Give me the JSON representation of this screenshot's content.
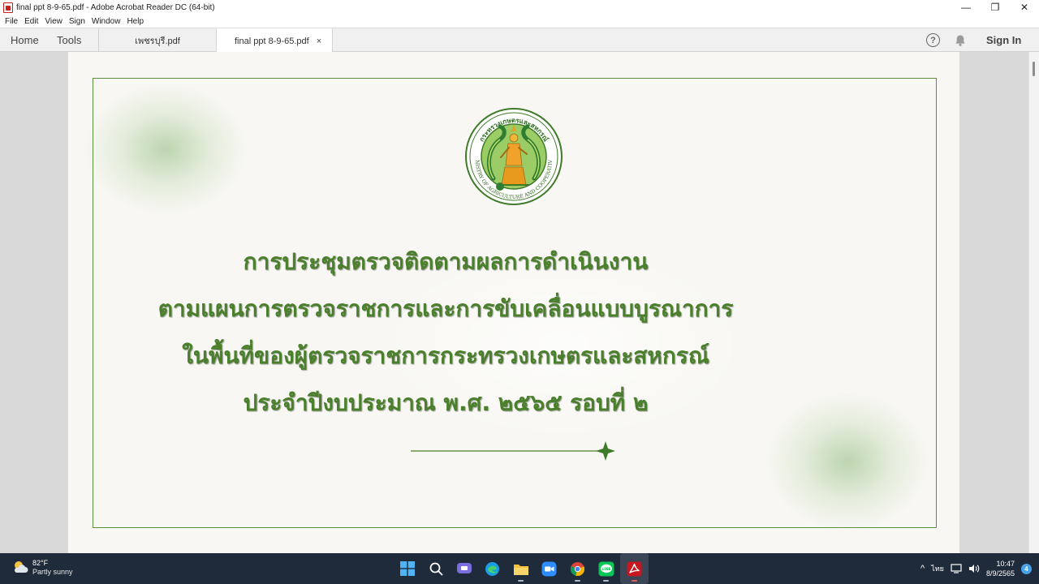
{
  "window": {
    "title": "final ppt 8-9-65.pdf - Adobe Acrobat Reader DC (64-bit)",
    "controls": {
      "minimize": "—",
      "restore": "❐",
      "close": "✕"
    }
  },
  "menu": [
    "File",
    "Edit",
    "View",
    "Sign",
    "Window",
    "Help"
  ],
  "toolbar": {
    "home": "Home",
    "tools": "Tools",
    "tabs": [
      {
        "label": "เพชรบุรี.pdf",
        "active": false
      },
      {
        "label": "final ppt 8-9-65.pdf",
        "active": true,
        "close": "×"
      }
    ],
    "help_icon": "?",
    "sign_in": "Sign In"
  },
  "document": {
    "seal_icon": "ministry-of-agriculture-seal",
    "title_lines": [
      "การประชุมตรวจติดตามผลการดำเนินงาน",
      "ตามแผนการตรวจราชการและการขับเคลื่อนแบบบูรณาการ",
      "ในพื้นที่ของผู้ตรวจราชการกระทรวงเกษตรและสหกรณ์",
      "ประจำปีงบประมาณ พ.ศ. ๒๕๖๕ รอบที่ ๒"
    ],
    "seal_text_top": "กระทรวงเกษตรและสหกรณ์",
    "seal_text_bottom": "MINISTRY OF AGRICULTURE AND COOPERATIVES",
    "accent_color": "#4a7f2b"
  },
  "taskbar": {
    "weather_temp": "82°F",
    "weather_desc": "Partly sunny",
    "apps": [
      "windows-start-icon",
      "search-icon",
      "chat-icon",
      "edge-icon",
      "file-explorer-icon",
      "zoom-icon",
      "chrome-icon",
      "line-icon",
      "acrobat-icon"
    ],
    "tray": {
      "chevron": "^",
      "language": "ไทย",
      "time": "10:47",
      "date": "8/9/2565",
      "notifications": "4"
    }
  }
}
